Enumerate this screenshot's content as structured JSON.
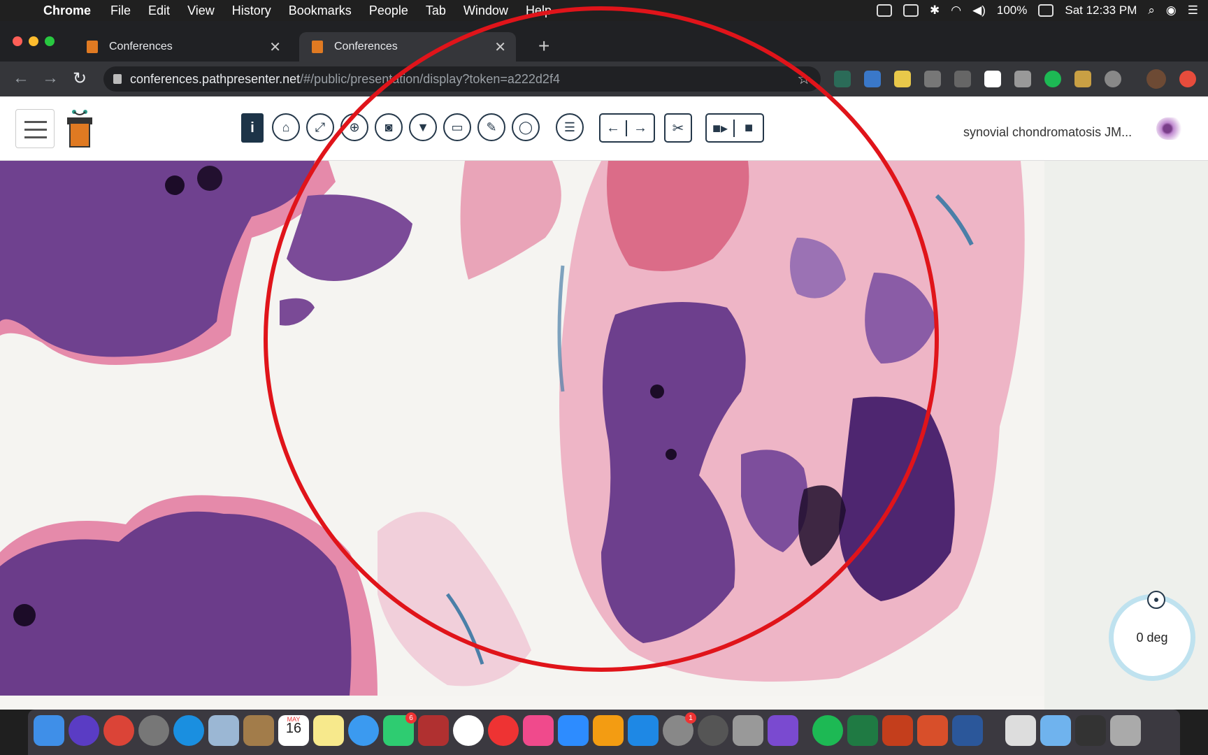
{
  "menubar": {
    "app": "Chrome",
    "items": [
      "File",
      "Edit",
      "View",
      "History",
      "Bookmarks",
      "People",
      "Tab",
      "Window",
      "Help"
    ],
    "battery": "100%",
    "clock": "Sat 12:33 PM"
  },
  "tabs": [
    {
      "title": "Conferences",
      "active": false
    },
    {
      "title": "Conferences",
      "active": true
    }
  ],
  "address": {
    "host": "conferences.pathpresenter.net",
    "path": "/#/public/presentation/display?token=a222d2f4"
  },
  "toolbar": {
    "info_label": "i",
    "tools": [
      "home-icon",
      "expand-icon",
      "zoom-in-icon",
      "camera-icon",
      "filter-icon",
      "monitor-icon",
      "pencil-icon",
      "lasso-icon",
      "list-icon"
    ],
    "nav": [
      "arrow-left-icon",
      "arrow-right-icon"
    ],
    "clip": "paperclip-icon",
    "record": [
      "video-camera-icon",
      "stop-icon"
    ]
  },
  "slide": {
    "title": "synovial chondromatosis JM..."
  },
  "rotation": {
    "label": "0 deg"
  },
  "colors": {
    "accent": "#25384a",
    "annotation": "#e0141a",
    "tissue_purple": "#6c3d8c",
    "tissue_pink": "#e07aa0"
  },
  "dock": {
    "calendar_month": "MAY",
    "calendar_day": "16",
    "messages_badge": "6",
    "settings_badge": "1"
  }
}
